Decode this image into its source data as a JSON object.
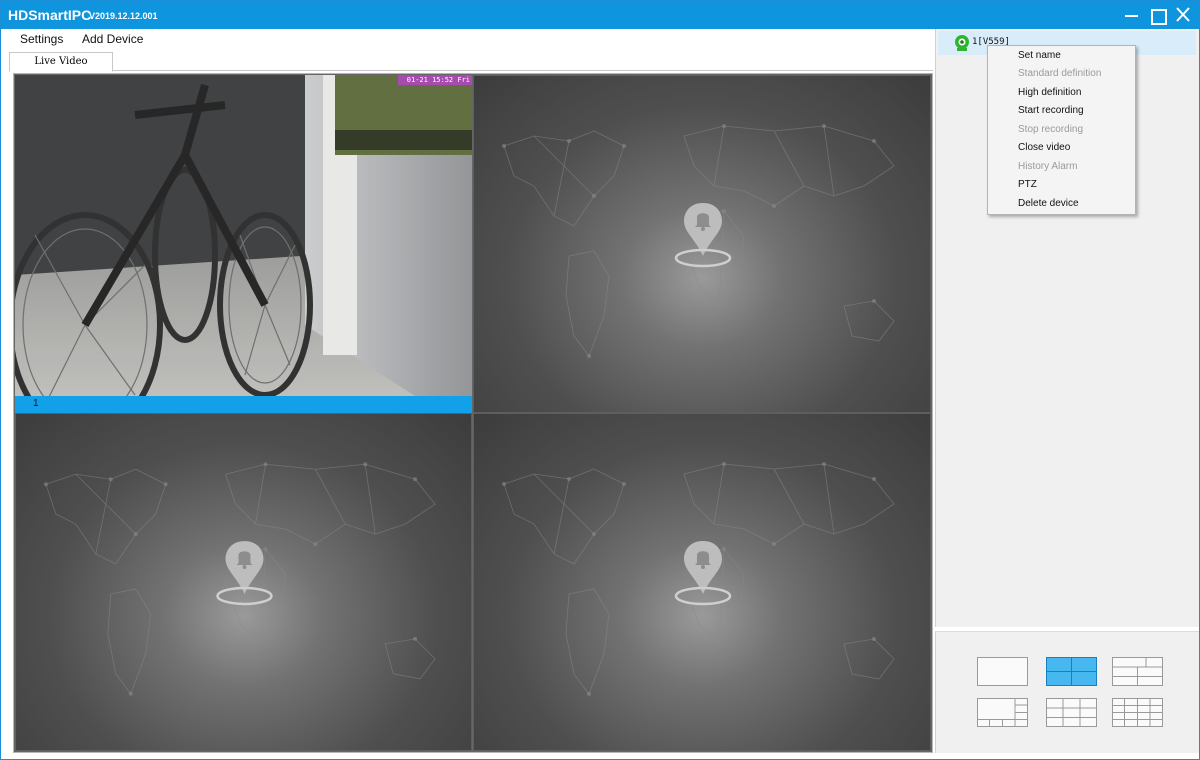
{
  "window": {
    "app_name": "HDSmartIPC",
    "version": "V2019.12.12.001",
    "accent_color": "#0f95dd"
  },
  "menu": {
    "settings": "Settings",
    "add_device": "Add Device"
  },
  "tabs": [
    {
      "label": "Live Video",
      "active": true
    }
  ],
  "video": {
    "layout": "4-split",
    "channels": [
      {
        "label": "1",
        "osd_text": "01-21 15:52 Fri",
        "status": "live"
      },
      {
        "label": "",
        "status": "empty"
      },
      {
        "label": "",
        "status": "empty"
      },
      {
        "label": "",
        "status": "empty"
      }
    ]
  },
  "sidebar": {
    "devices": [
      {
        "name": "1[V559]",
        "icon": "webcam-icon",
        "status_color": "#2db52d"
      }
    ]
  },
  "context_menu": {
    "items": [
      {
        "label": "Set name",
        "enabled": true
      },
      {
        "label": "Standard definition",
        "enabled": false
      },
      {
        "label": "High definition",
        "enabled": true
      },
      {
        "label": "Start recording",
        "enabled": true
      },
      {
        "label": "Stop recording",
        "enabled": false
      },
      {
        "label": "Close video",
        "enabled": true
      },
      {
        "label": "History Alarm",
        "enabled": false
      },
      {
        "label": "PTZ",
        "enabled": true
      },
      {
        "label": "Delete device",
        "enabled": true
      }
    ]
  },
  "layouts": {
    "options": [
      "1-split",
      "4-split",
      "6-split",
      "8-split",
      "9-split",
      "16-split"
    ],
    "selected": "4-split",
    "selected_color": "#47b7ef"
  }
}
